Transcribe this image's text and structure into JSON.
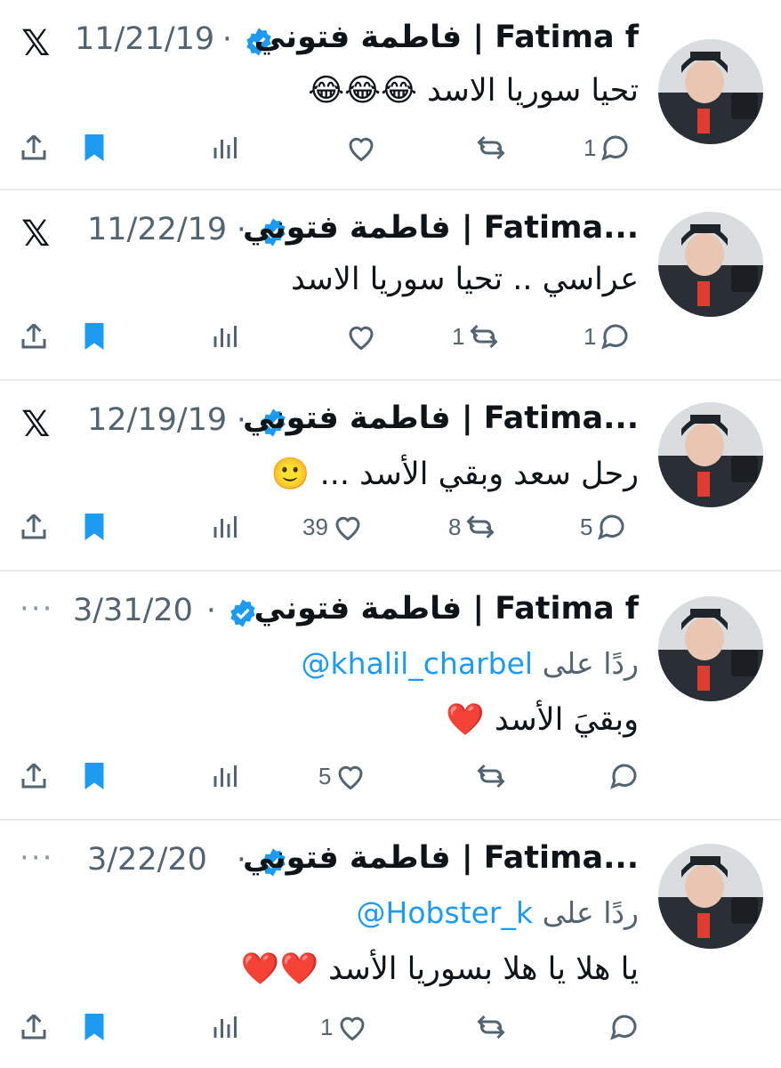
{
  "tweets": [
    {
      "name": "فاطمة فتوني | Fatima f",
      "date": "11/21/19",
      "separator": "·",
      "corner": "x-logo",
      "body": "تحيا سوريا الاسد 😂😂😂",
      "counts": {
        "reply": "1",
        "retweet": "",
        "like": ""
      }
    },
    {
      "name": "فاطمة فتوني | Fatima...",
      "date": "11/22/19",
      "separator": "·",
      "corner": "x-logo",
      "body": "عراسي .. تحيا سوريا الاسد",
      "counts": {
        "reply": "1",
        "retweet": "1",
        "like": ""
      }
    },
    {
      "name": "فاطمة فتوني | Fatima...",
      "date": "12/19/19",
      "separator": "·",
      "corner": "x-logo",
      "body": "رحل سعد وبقي الأسد ... 🙂",
      "counts": {
        "reply": "5",
        "retweet": "8",
        "like": "39"
      }
    },
    {
      "name": "فاطمة فتوني | Fatima f",
      "date": "3/31/20",
      "separator": "·",
      "corner": "more-dots",
      "reply_prefix": "ردًا على",
      "reply_to": "@khalil_charbel",
      "body": "وبقيَ الأسد ❤️",
      "counts": {
        "reply": "",
        "retweet": "",
        "like": "5"
      }
    },
    {
      "name": "فاطمة فتوني | Fatima...",
      "date": "3/22/20",
      "separator": "·",
      "corner": "more-dots",
      "reply_prefix": "ردًا على",
      "reply_to": "@Hobster_k",
      "body": "يا هلا يا هلا بسوريا الأسد ❤️❤️",
      "counts": {
        "reply": "",
        "retweet": "",
        "like": "1"
      }
    }
  ],
  "ui": {
    "x_logo": "𝕏",
    "more_dots": "···"
  },
  "colors": {
    "accent": "#1d9bf0",
    "muted": "#536471",
    "text": "#0f1419",
    "divider": "#e7e9ec"
  },
  "icons": [
    "share-icon",
    "bookmark-icon",
    "views-icon",
    "like-icon",
    "retweet-icon",
    "reply-icon",
    "verified-badge-icon"
  ]
}
